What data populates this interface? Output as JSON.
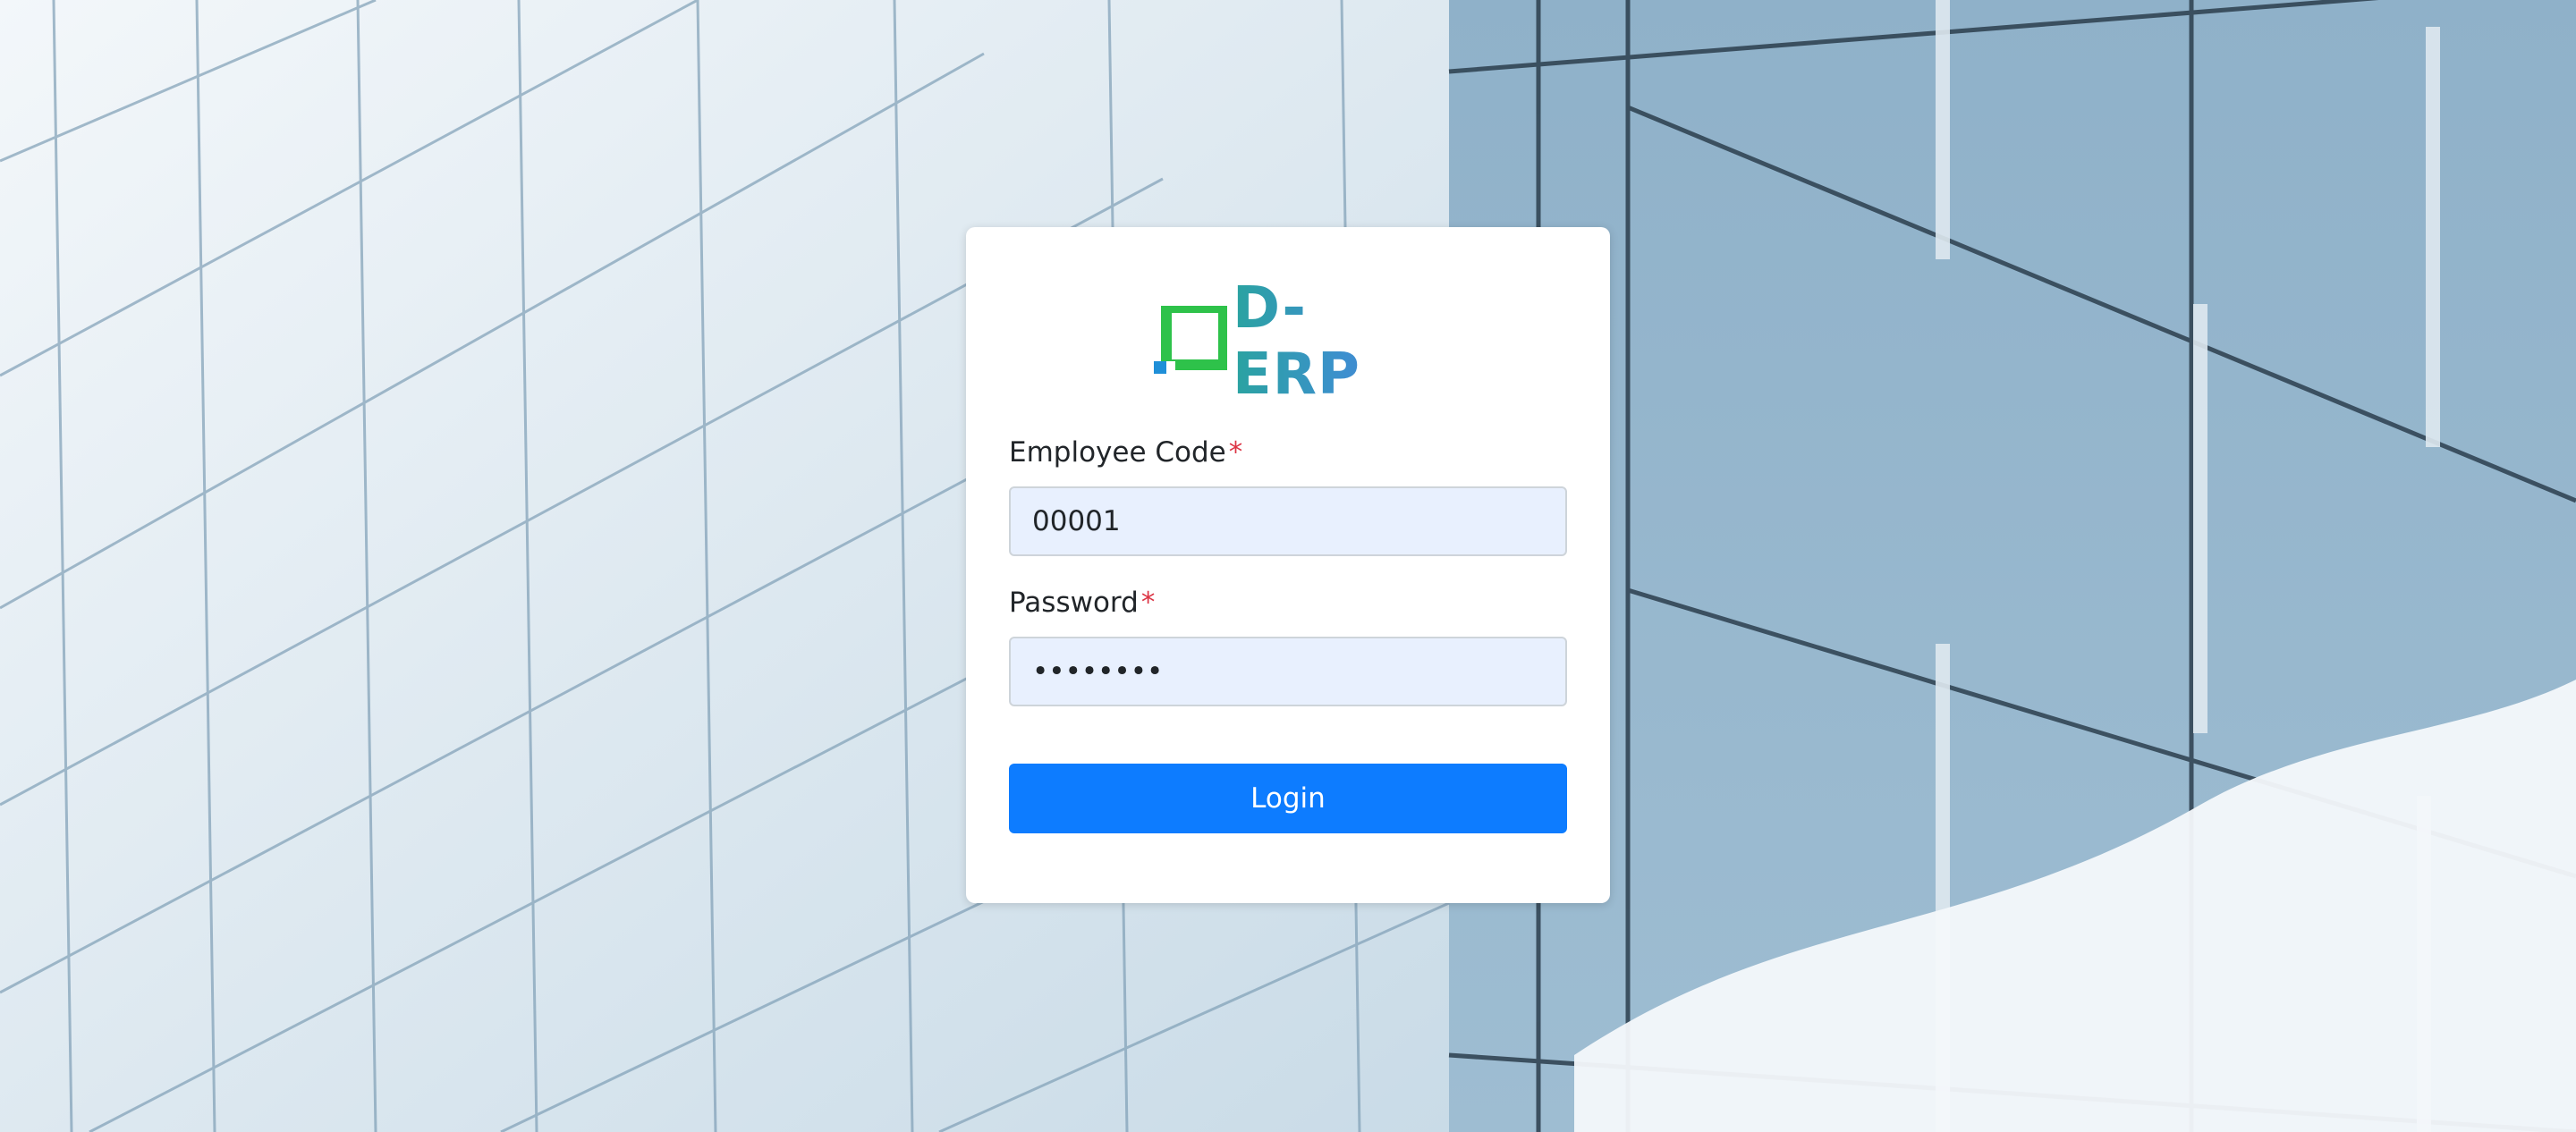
{
  "app": {
    "logo_text": "D-ERP",
    "brand_colors": {
      "mark_green": "#2ec24a",
      "mark_blue": "#1f8fd8",
      "text_start": "#2aa3a0",
      "text_end": "#4b7fd0"
    }
  },
  "form": {
    "employee_code": {
      "label": "Employee Code",
      "required_mark": "*",
      "value": "00001"
    },
    "password": {
      "label": "Password",
      "required_mark": "*",
      "value": "••••••••"
    },
    "login_button": {
      "label": "Login",
      "color": "#0d7cff"
    }
  },
  "icons": {
    "logo_mark": "square-bracket-logo-icon"
  }
}
